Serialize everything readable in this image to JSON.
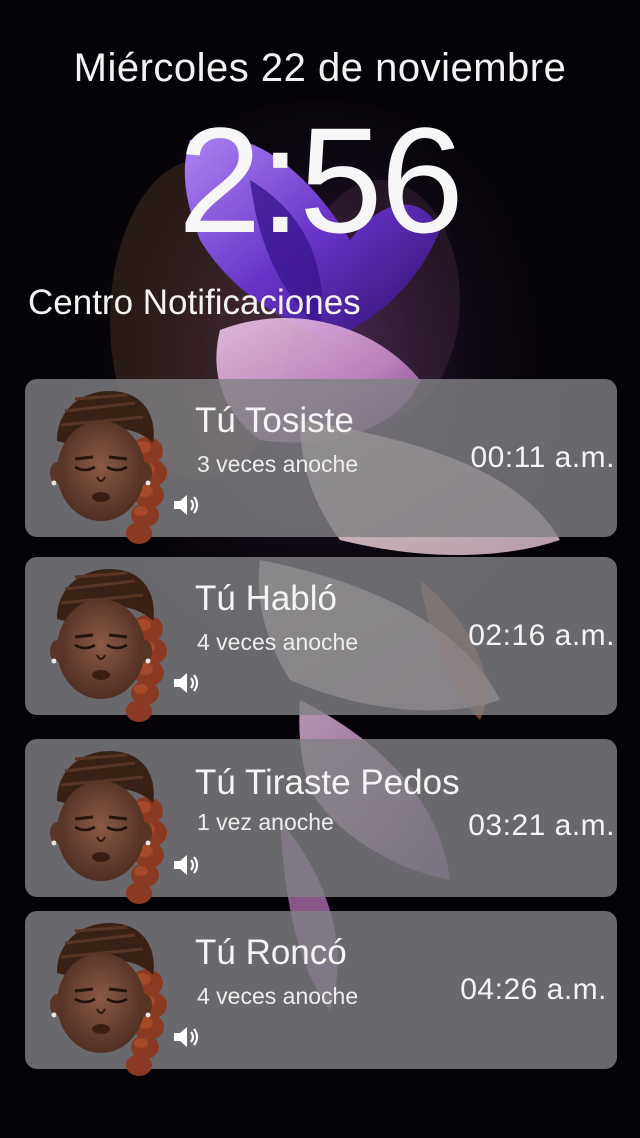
{
  "lockscreen": {
    "date": "Miércoles 22 de noviembre",
    "time": "2:56",
    "section_title": "Centro Notificaciones"
  },
  "notifications": [
    {
      "title": "Tú Tosiste",
      "subtitle": "3 veces anoche",
      "time": "00:11 a.m.",
      "icon": "speaker-icon"
    },
    {
      "title": "Tú Habló",
      "subtitle": "4 veces anoche",
      "time": "02:16 a.m.",
      "icon": "speaker-icon"
    },
    {
      "title": "Tú Tiraste Pedos",
      "subtitle": "1 vez anoche",
      "time": "03:21 a.m.",
      "icon": "speaker-icon"
    },
    {
      "title": "Tú Roncó",
      "subtitle": "4 veces anoche",
      "time": "04:26 a.m.",
      "icon": "speaker-icon"
    }
  ],
  "colors": {
    "background": "#050307",
    "card": "#808084",
    "wallpaper_accent": "#7b4fd6",
    "wave_gradient": [
      "#ff3ec8",
      "#ffd23c",
      "#3cff8c",
      "#3cb4ff",
      "#b43cff"
    ]
  }
}
